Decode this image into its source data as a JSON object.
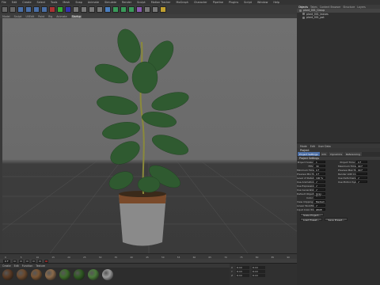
{
  "menubar": {
    "items": [
      "File",
      "Edit",
      "Create",
      "Select",
      "Tools",
      "Mesh",
      "Snap",
      "Animate",
      "Simulate",
      "Render",
      "Sculpt",
      "Motion Tracker",
      "MoGraph",
      "Character",
      "Pipeline",
      "Plugins",
      "Script",
      "Window",
      "Help"
    ]
  },
  "modes": {
    "items": [
      "Model",
      "Sculpt",
      "UVEdit",
      "Paint",
      "Rig",
      "Animate",
      "Startup"
    ],
    "active_index": 6
  },
  "objects": {
    "tabs": [
      "Objects",
      "Takes",
      "Content Browser",
      "Structure",
      "Layers"
    ],
    "active_tab": 0,
    "rows": [
      "plant_001_Group",
      "plant_001_leaves",
      "plant_001_pot"
    ]
  },
  "attributes": {
    "menu": [
      "Mode",
      "Edit",
      "User Data"
    ],
    "header": "Project",
    "tabs": [
      "Project Settings",
      "Info",
      "Dynamics",
      "Referencing"
    ],
    "section": "Project Settings",
    "fields": [
      {
        "label": "Project Scale",
        "value": "1"
      },
      {
        "label": "FPS",
        "value": "30"
      },
      {
        "label": "Minimum Time",
        "value": "0 F"
      },
      {
        "label": "Preview Min Time",
        "value": "0 F"
      },
      {
        "label": "Level of Detail",
        "value": "100 %"
      },
      {
        "label": "Use Animation",
        "value": "✔"
      },
      {
        "label": "Use Expression",
        "value": "✔"
      },
      {
        "label": "Use Generators",
        "value": "✔"
      },
      {
        "label": "Default Object Color",
        "value": "Gray-Blue"
      },
      {
        "label": "Color",
        "value": ""
      },
      {
        "label": "View Clipping",
        "value": "Medium"
      },
      {
        "label": "Linear Workflow",
        "value": "✔"
      },
      {
        "label": "Input Color Profile",
        "value": "sRGB"
      }
    ],
    "right_fields": [
      {
        "label": "Project Time",
        "value": "0 F"
      },
      {
        "label": "Maximum Time",
        "value": "90 F"
      },
      {
        "label": "Preview Max Time",
        "value": "90 F"
      },
      {
        "label": "Render LOD in Editor",
        "value": ""
      },
      {
        "label": "Use Deformers",
        "value": "✔"
      },
      {
        "label": "Use Motion System",
        "value": "✔"
      }
    ],
    "scale_button": "Scale Project...",
    "load_button": "Load Preset...",
    "save_button": "Save Preset..."
  },
  "timeline": {
    "ticks": [
      "0",
      "5",
      "10",
      "15",
      "20",
      "25",
      "30",
      "35",
      "40",
      "45",
      "50",
      "55",
      "60",
      "65",
      "70",
      "75",
      "80",
      "85",
      "90"
    ],
    "frame": "0 F"
  },
  "materials": {
    "menu": [
      "Create",
      "Edit",
      "Function",
      "Texture"
    ],
    "balls": [
      "#5a3a24",
      "#6b4a2e",
      "#7a5533",
      "#8a6a4a",
      "#3d6b2a",
      "#2f5a22",
      "#4a7a3a",
      "#9a9a9a"
    ]
  },
  "coords": {
    "rows": [
      {
        "axis": "X",
        "pos": "0 cm",
        "size": "0 cm"
      },
      {
        "axis": "Y",
        "pos": "0 cm",
        "size": "0 cm"
      },
      {
        "axis": "Z",
        "pos": "0 cm",
        "size": "0 cm"
      }
    ]
  }
}
